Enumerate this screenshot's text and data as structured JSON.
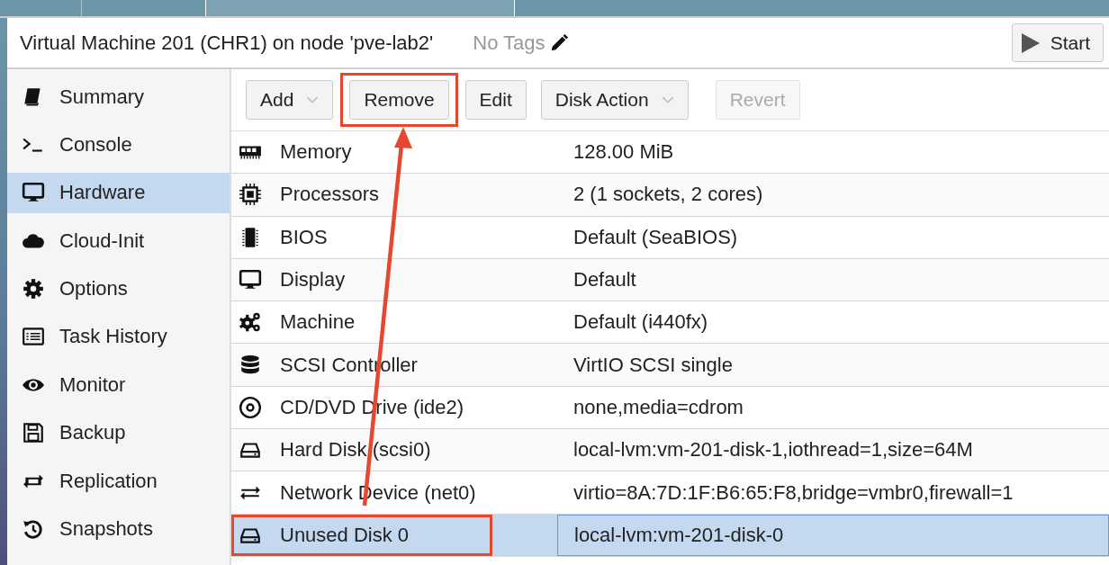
{
  "header": {
    "title": "Virtual Machine 201 (CHR1) on node 'pve-lab2'",
    "tags_label": "No Tags",
    "start_button": "Start"
  },
  "sidebar": {
    "items": [
      {
        "kind": "summary",
        "label": "Summary",
        "selected": false
      },
      {
        "kind": "console",
        "label": "Console",
        "selected": false
      },
      {
        "kind": "hardware",
        "label": "Hardware",
        "selected": true
      },
      {
        "kind": "cloud",
        "label": "Cloud-Init",
        "selected": false
      },
      {
        "kind": "options",
        "label": "Options",
        "selected": false
      },
      {
        "kind": "tasks",
        "label": "Task History",
        "selected": false
      },
      {
        "kind": "monitor",
        "label": "Monitor",
        "selected": false
      },
      {
        "kind": "backup",
        "label": "Backup",
        "selected": false
      },
      {
        "kind": "replication",
        "label": "Replication",
        "selected": false
      },
      {
        "kind": "snapshots",
        "label": "Snapshots",
        "selected": false
      }
    ]
  },
  "toolbar": {
    "buttons": [
      {
        "label": "Add",
        "dropdown": true,
        "disabled": false,
        "highlighted": false
      },
      {
        "label": "Remove",
        "dropdown": false,
        "disabled": false,
        "highlighted": true
      },
      {
        "label": "Edit",
        "dropdown": false,
        "disabled": false,
        "highlighted": false
      },
      {
        "label": "Disk Action",
        "dropdown": true,
        "disabled": false,
        "highlighted": false
      },
      {
        "label": "Revert",
        "dropdown": false,
        "disabled": true,
        "highlighted": false
      }
    ]
  },
  "hardware": {
    "rows": [
      {
        "kind": "memory",
        "name": "Memory",
        "value": "128.00 MiB",
        "selected": false,
        "highlighted": false
      },
      {
        "kind": "cpu",
        "name": "Processors",
        "value": "2 (1 sockets, 2 cores)",
        "selected": false,
        "highlighted": false
      },
      {
        "kind": "bios",
        "name": "BIOS",
        "value": "Default (SeaBIOS)",
        "selected": false,
        "highlighted": false
      },
      {
        "kind": "display",
        "name": "Display",
        "value": "Default",
        "selected": false,
        "highlighted": false
      },
      {
        "kind": "machine",
        "name": "Machine",
        "value": "Default (i440fx)",
        "selected": false,
        "highlighted": false
      },
      {
        "kind": "scsi",
        "name": "SCSI Controller",
        "value": "VirtIO SCSI single",
        "selected": false,
        "highlighted": false
      },
      {
        "kind": "cdrom",
        "name": "CD/DVD Drive (ide2)",
        "value": "none,media=cdrom",
        "selected": false,
        "highlighted": false
      },
      {
        "kind": "disk",
        "name": "Hard Disk (scsi0)",
        "value": "local-lvm:vm-201-disk-1,iothread=1,size=64M",
        "selected": false,
        "highlighted": false
      },
      {
        "kind": "network",
        "name": "Network Device (net0)",
        "value": "virtio=8A:7D:1F:B6:65:F8,bridge=vmbr0,firewall=1",
        "selected": false,
        "highlighted": false
      },
      {
        "kind": "disk",
        "name": "Unused Disk 0",
        "value": "local-lvm:vm-201-disk-0",
        "selected": true,
        "highlighted": true
      }
    ]
  },
  "annotation_arrow": {
    "shown": true
  }
}
